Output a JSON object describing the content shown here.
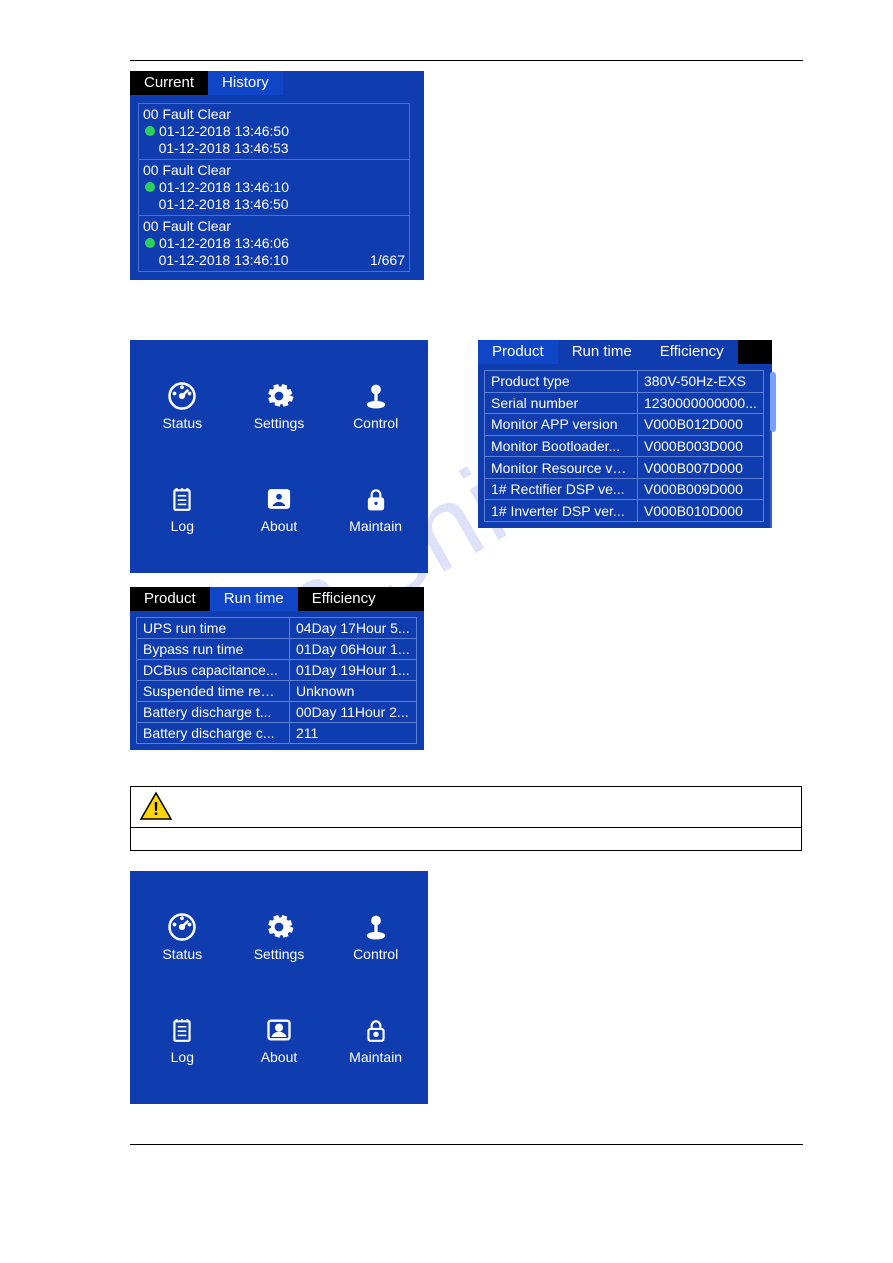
{
  "history_panel": {
    "tabs": {
      "current": "Current",
      "history": "History"
    },
    "items": [
      {
        "code": "00",
        "title": "Fault Clear",
        "t1": "01-12-2018 13:46:50",
        "t2": "01-12-2018 13:46:53"
      },
      {
        "code": "00",
        "title": "Fault Clear",
        "t1": "01-12-2018 13:46:10",
        "t2": "01-12-2018 13:46:50"
      },
      {
        "code": "00",
        "title": "Fault Clear",
        "t1": "01-12-2018 13:46:06",
        "t2": "01-12-2018 13:46:10"
      }
    ],
    "pager": "1/667"
  },
  "menu": {
    "status": "Status",
    "settings": "Settings",
    "control": "Control",
    "log": "Log",
    "about": "About",
    "maintain": "Maintain"
  },
  "product_panel": {
    "tabs": {
      "product": "Product",
      "runtime": "Run time",
      "efficiency": "Efficiency"
    },
    "rows": [
      {
        "k": "Product type",
        "v": "380V-50Hz-EXS"
      },
      {
        "k": "Serial number",
        "v": "1230000000000..."
      },
      {
        "k": "Monitor APP version",
        "v": "V000B012D000"
      },
      {
        "k": "Monitor Bootloader...",
        "v": "V000B003D000"
      },
      {
        "k": "Monitor Resource ve...",
        "v": "V000B007D000"
      },
      {
        "k": "1# Rectifier DSP ve...",
        "v": "V000B009D000"
      },
      {
        "k": "1# Inverter DSP ver...",
        "v": "V000B010D000"
      }
    ]
  },
  "runtime_panel": {
    "tabs": {
      "product": "Product",
      "runtime": "Run time",
      "efficiency": "Efficiency"
    },
    "rows": [
      {
        "k": "UPS run time",
        "v": "04Day 17Hour 5..."
      },
      {
        "k": "Bypass run time",
        "v": "01Day 06Hour 1..."
      },
      {
        "k": "DCBus capacitance...",
        "v": "01Day 19Hour 1..."
      },
      {
        "k": "Suspended time rem...",
        "v": "Unknown"
      },
      {
        "k": "Battery discharge t...",
        "v": "00Day 11Hour 2..."
      },
      {
        "k": "Battery discharge c...",
        "v": "211"
      }
    ]
  },
  "watermark": "man    shiv"
}
